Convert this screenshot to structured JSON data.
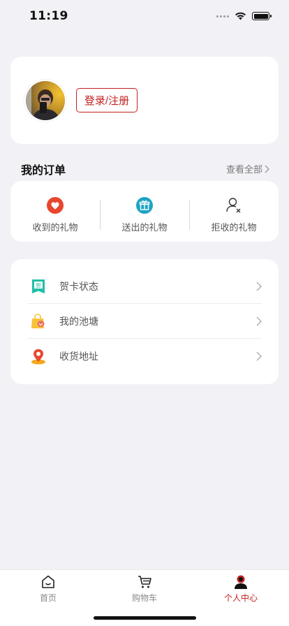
{
  "status_bar": {
    "time": "11:19"
  },
  "profile": {
    "login_label": "登录/注册"
  },
  "orders": {
    "title": "我的订单",
    "view_all": "查看全部",
    "items": [
      {
        "label": "收到的礼物",
        "icon": "heart-gift-icon"
      },
      {
        "label": "送出的礼物",
        "icon": "gift-box-icon"
      },
      {
        "label": "拒收的礼物",
        "icon": "user-reject-icon"
      }
    ]
  },
  "menu": {
    "items": [
      {
        "label": "贺卡状态",
        "icon": "greeting-card-icon"
      },
      {
        "label": "我的池塘",
        "icon": "shopping-bag-icon"
      },
      {
        "label": "收货地址",
        "icon": "location-pin-icon"
      }
    ]
  },
  "tabs": [
    {
      "label": "首页",
      "icon": "home-icon"
    },
    {
      "label": "购物车",
      "icon": "cart-icon"
    },
    {
      "label": "个人中心",
      "icon": "person-icon",
      "active": true
    }
  ],
  "colors": {
    "accent": "#c0201e",
    "background": "#f1f1f6",
    "heart_orange": "#e8462e",
    "gift_teal": "#1ea4c4",
    "card_teal": "#1fbfa5"
  }
}
